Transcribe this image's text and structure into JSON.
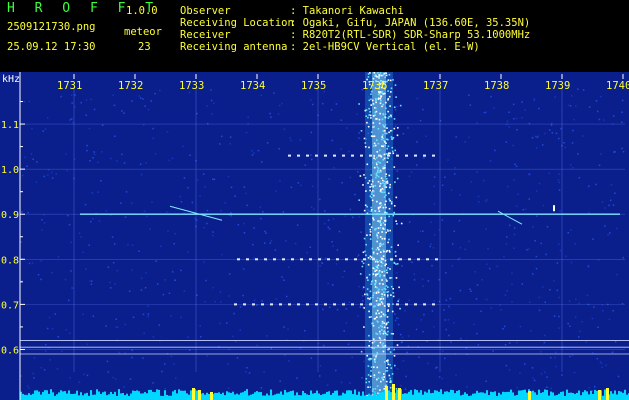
{
  "header": {
    "app_name": "H R O F F T",
    "version": "1.0.0",
    "filename": "2509121730.png",
    "datetime": "25.09.12 17:30",
    "meteor_label": "meteor",
    "meteor_count": "23",
    "info": [
      {
        "label": "Observer",
        "value": ": Takanori Kawachi"
      },
      {
        "label": "Receiving Location",
        "value": ": Ogaki, Gifu, JAPAN (136.60E, 35.35N)"
      },
      {
        "label": "Receiver",
        "value": ": R820T2(RTL-SDR) SDR-Sharp 53.1000MHz"
      },
      {
        "label": "Receiving antenna",
        "value": ": 2el-HB9CV Vertical (el. E-W)"
      }
    ]
  },
  "chart_data": {
    "type": "heatmap",
    "x_unit": "time (minute labels)",
    "x_ticks": [
      "1731",
      "1732",
      "1733",
      "1734",
      "1735",
      "1736",
      "1737",
      "1738",
      "1739",
      "1740"
    ],
    "y_unit": "kHz",
    "y_ticks": [
      "1.1",
      "1.0",
      "0.9",
      "0.8",
      "0.7",
      "0.6"
    ],
    "ylim": [
      0.55,
      1.18
    ],
    "colors": {
      "background": "#0a1f8c",
      "tick_label": "#ffff33",
      "axis_label": "#ffffff",
      "signal": "#ffffff",
      "baseline": "#00d8ff"
    },
    "features": [
      {
        "kind": "vertical-band",
        "x": "1736",
        "note": "strong broadband noise"
      },
      {
        "kind": "horizontal-line",
        "y": 0.9
      }
    ]
  }
}
